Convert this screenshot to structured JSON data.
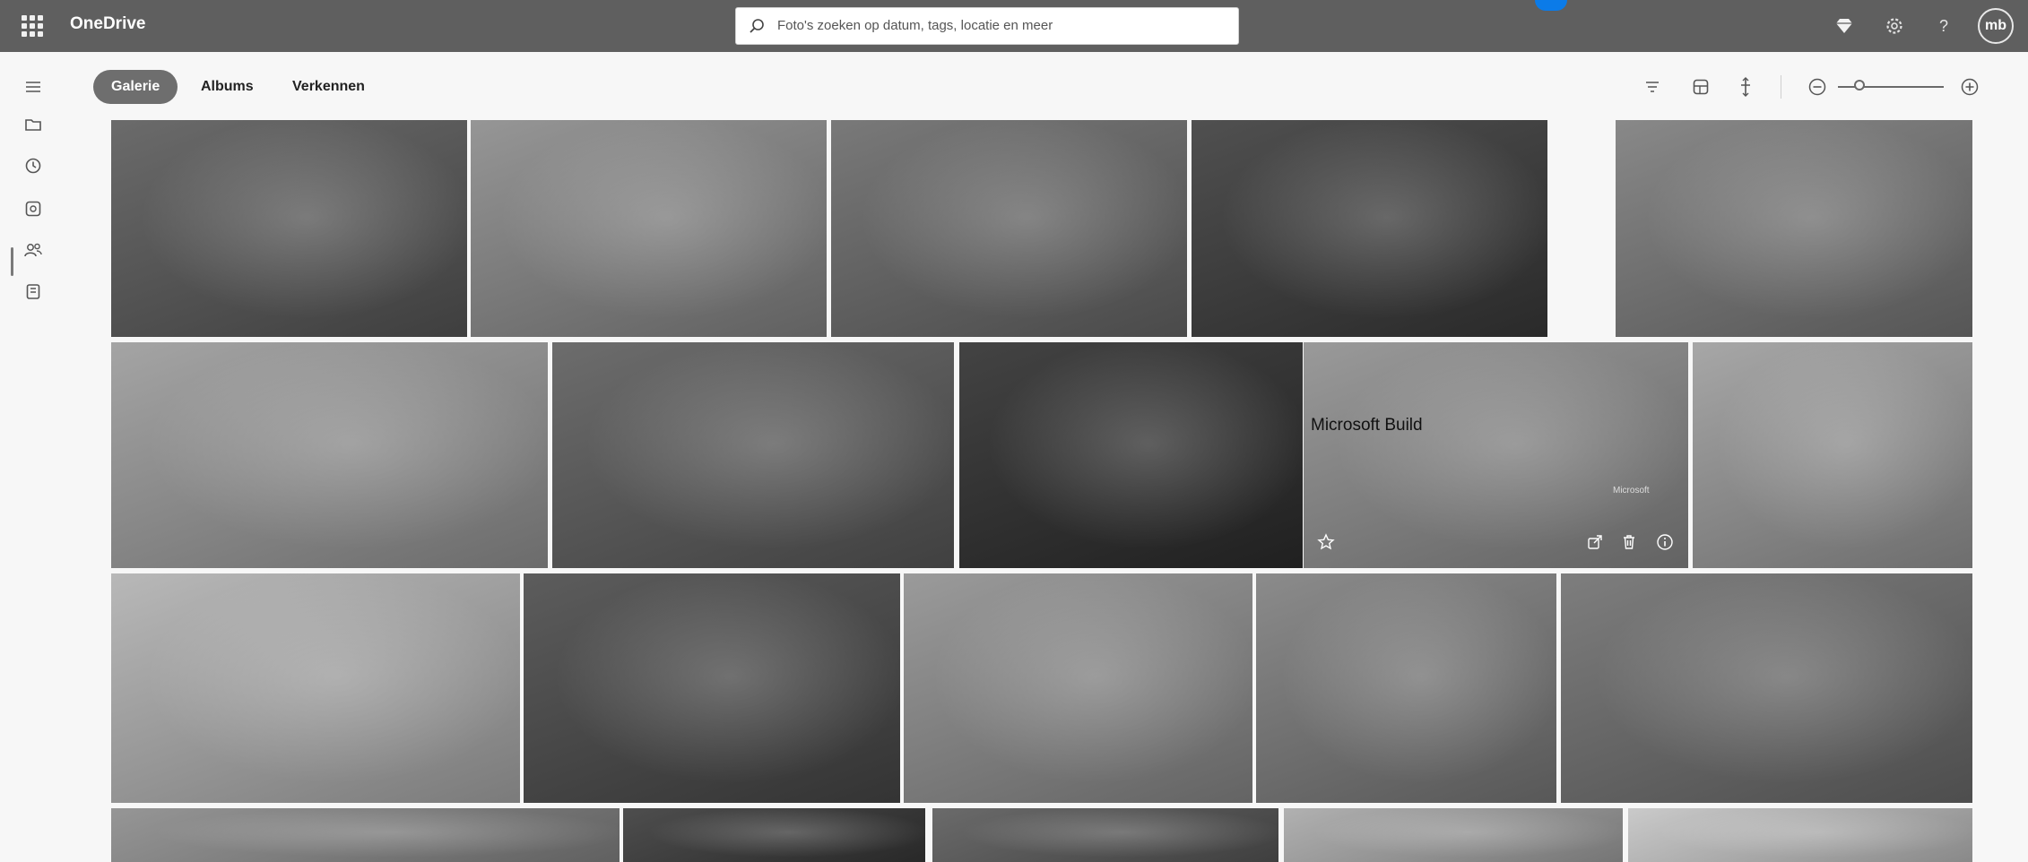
{
  "app": {
    "name": "OneDrive"
  },
  "search": {
    "placeholder": "Foto's zoeken op datum, tags, locatie en meer"
  },
  "user": {
    "initials": "mb"
  },
  "tabs": [
    {
      "label": "Galerie",
      "active": true
    },
    {
      "label": "Albums",
      "active": false
    },
    {
      "label": "Verkennen",
      "active": false
    }
  ],
  "hover_photo": {
    "caption": "Microsoft Build",
    "badge": "Microsoft"
  },
  "topbar_icons": [
    "waffle-icon",
    "diamond-icon",
    "gear-icon",
    "help-icon"
  ],
  "rail_icons": [
    "hamburger-icon",
    "folder-icon",
    "recent-icon",
    "photos-icon",
    "people-icon",
    "recycle-bin-icon"
  ],
  "toolbar_icons": [
    "filter-icon",
    "layout-icon",
    "timeline-icon",
    "zoom-out-icon",
    "zoom-slider",
    "zoom-in-icon"
  ],
  "photo_overlay_icons": [
    "favorite-star-icon",
    "share-icon",
    "delete-icon",
    "info-icon"
  ],
  "photos": [
    {
      "name": "photo-pike-place-market",
      "tone": "#5a5a5a"
    },
    {
      "name": "photo-open-office",
      "tone": "#8a8a8a"
    },
    {
      "name": "photo-campus-courtyard",
      "tone": "#6a6a6a"
    },
    {
      "name": "photo-presenter-screen",
      "tone": "#3c3c3c"
    },
    {
      "name": "photo-man-at-desk",
      "tone": "#7b7b7b"
    },
    {
      "name": "photo-round-table-meeting",
      "tone": "#9a9a9a"
    },
    {
      "name": "photo-speaker-studio",
      "tone": "#5c5c5c"
    },
    {
      "name": "photo-keynote-stage",
      "tone": "#2e2e2e"
    },
    {
      "name": "photo-microsoft-build",
      "tone": "#8e8e8e"
    },
    {
      "name": "photo-team-laptop",
      "tone": "#9d9d9d"
    },
    {
      "name": "photo-coding-laptop",
      "tone": "#b0b0b0"
    },
    {
      "name": "photo-meeting-laughing",
      "tone": "#4a4a4a"
    },
    {
      "name": "photo-group-discussion",
      "tone": "#8f8f8f"
    },
    {
      "name": "photo-two-women-smiling",
      "tone": "#7e7e7e"
    },
    {
      "name": "photo-portrait-man",
      "tone": "#6f6f6f"
    },
    {
      "name": "photo-row4-a",
      "tone": "#8a8a8a"
    },
    {
      "name": "photo-row4-b",
      "tone": "#3a3a3a"
    },
    {
      "name": "photo-row4-c",
      "tone": "#5a5a5a"
    },
    {
      "name": "photo-row4-d",
      "tone": "#a8a8a8"
    },
    {
      "name": "photo-row4-e",
      "tone": "#c4c4c4"
    }
  ]
}
